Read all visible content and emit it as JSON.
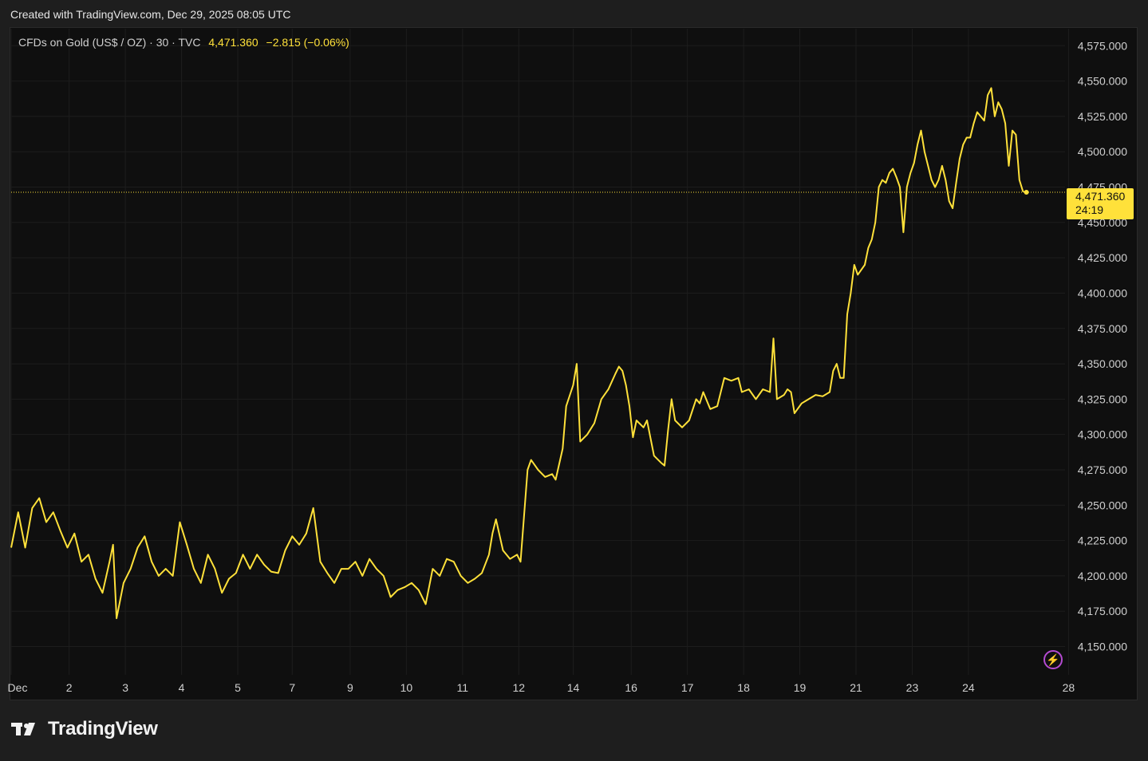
{
  "header": {
    "created_text": "Created with TradingView.com, Dec 29, 2025 08:05 UTC"
  },
  "legend": {
    "symbol": "CFDs on Gold (US$ / OZ) · 30 · TVC",
    "price": "4,471.360",
    "change": "−2.815 (−0.06%)"
  },
  "price_label": {
    "price": "4,471.360",
    "countdown": "24:19"
  },
  "brand": {
    "name": "TradingView"
  },
  "colors": {
    "line": "#ffe13a",
    "background": "#0f0f0f",
    "grid": "#1d1d1d",
    "axis_text": "#cfcfcf",
    "outer": "#1e1e1e"
  },
  "chart_data": {
    "type": "line",
    "series": [
      {
        "values": [
          [
            0,
            4220
          ],
          [
            4,
            4245
          ],
          [
            8,
            4220
          ],
          [
            12,
            4248
          ],
          [
            16,
            4255
          ],
          [
            20,
            4238
          ],
          [
            24,
            4245
          ],
          [
            28,
            4232
          ],
          [
            32,
            4220
          ],
          [
            36,
            4230
          ],
          [
            40,
            4210
          ],
          [
            44,
            4215
          ],
          [
            48,
            4198
          ],
          [
            52,
            4188
          ],
          [
            56,
            4210
          ],
          [
            58,
            4222
          ],
          [
            60,
            4170
          ],
          [
            64,
            4195
          ],
          [
            68,
            4205
          ],
          [
            72,
            4220
          ],
          [
            76,
            4228
          ],
          [
            80,
            4210
          ],
          [
            84,
            4200
          ],
          [
            88,
            4205
          ],
          [
            92,
            4200
          ],
          [
            96,
            4238
          ],
          [
            100,
            4222
          ],
          [
            104,
            4205
          ],
          [
            108,
            4195
          ],
          [
            112,
            4215
          ],
          [
            116,
            4205
          ],
          [
            120,
            4188
          ],
          [
            124,
            4198
          ],
          [
            128,
            4202
          ],
          [
            132,
            4215
          ],
          [
            136,
            4205
          ],
          [
            140,
            4215
          ],
          [
            144,
            4208
          ],
          [
            148,
            4203
          ],
          [
            152,
            4202
          ],
          [
            156,
            4218
          ],
          [
            160,
            4228
          ],
          [
            164,
            4222
          ],
          [
            168,
            4230
          ],
          [
            172,
            4248
          ],
          [
            176,
            4210
          ],
          [
            180,
            4202
          ],
          [
            184,
            4195
          ],
          [
            188,
            4205
          ],
          [
            192,
            4205
          ],
          [
            196,
            4210
          ],
          [
            200,
            4200
          ],
          [
            204,
            4212
          ],
          [
            208,
            4205
          ],
          [
            212,
            4200
          ],
          [
            216,
            4185
          ],
          [
            220,
            4190
          ],
          [
            224,
            4192
          ],
          [
            228,
            4195
          ],
          [
            232,
            4190
          ],
          [
            236,
            4180
          ],
          [
            240,
            4205
          ],
          [
            244,
            4200
          ],
          [
            248,
            4212
          ],
          [
            252,
            4210
          ],
          [
            256,
            4200
          ],
          [
            260,
            4195
          ],
          [
            264,
            4198
          ],
          [
            268,
            4202
          ],
          [
            272,
            4215
          ],
          [
            274,
            4230
          ],
          [
            276,
            4240
          ],
          [
            280,
            4218
          ],
          [
            284,
            4212
          ],
          [
            288,
            4215
          ],
          [
            290,
            4210
          ],
          [
            294,
            4275
          ],
          [
            296,
            4282
          ],
          [
            300,
            4275
          ],
          [
            304,
            4270
          ],
          [
            308,
            4272
          ],
          [
            310,
            4268
          ],
          [
            314,
            4290
          ],
          [
            316,
            4320
          ],
          [
            320,
            4335
          ],
          [
            322,
            4350
          ],
          [
            324,
            4295
          ],
          [
            328,
            4300
          ],
          [
            332,
            4308
          ],
          [
            336,
            4325
          ],
          [
            340,
            4332
          ],
          [
            344,
            4343
          ],
          [
            346,
            4348
          ],
          [
            348,
            4345
          ],
          [
            350,
            4335
          ],
          [
            352,
            4320
          ],
          [
            354,
            4298
          ],
          [
            356,
            4310
          ],
          [
            360,
            4305
          ],
          [
            362,
            4310
          ],
          [
            366,
            4285
          ],
          [
            370,
            4280
          ],
          [
            372,
            4278
          ],
          [
            374,
            4303
          ],
          [
            376,
            4325
          ],
          [
            378,
            4310
          ],
          [
            382,
            4305
          ],
          [
            386,
            4310
          ],
          [
            390,
            4325
          ],
          [
            392,
            4322
          ],
          [
            394,
            4330
          ],
          [
            398,
            4318
          ],
          [
            402,
            4320
          ],
          [
            406,
            4340
          ],
          [
            410,
            4338
          ],
          [
            414,
            4340
          ],
          [
            416,
            4330
          ],
          [
            420,
            4332
          ],
          [
            424,
            4325
          ],
          [
            428,
            4332
          ],
          [
            432,
            4330
          ],
          [
            434,
            4368
          ],
          [
            436,
            4325
          ],
          [
            440,
            4328
          ],
          [
            442,
            4332
          ],
          [
            444,
            4330
          ],
          [
            446,
            4315
          ],
          [
            450,
            4322
          ],
          [
            454,
            4325
          ],
          [
            458,
            4328
          ],
          [
            462,
            4327
          ],
          [
            466,
            4330
          ],
          [
            468,
            4345
          ],
          [
            470,
            4350
          ],
          [
            472,
            4340
          ],
          [
            474,
            4340
          ],
          [
            476,
            4385
          ],
          [
            478,
            4400
          ],
          [
            480,
            4420
          ],
          [
            482,
            4413
          ],
          [
            486,
            4420
          ],
          [
            488,
            4432
          ],
          [
            490,
            4438
          ],
          [
            492,
            4450
          ],
          [
            494,
            4475
          ],
          [
            496,
            4480
          ],
          [
            498,
            4478
          ],
          [
            500,
            4485
          ],
          [
            502,
            4488
          ],
          [
            504,
            4482
          ],
          [
            506,
            4475
          ],
          [
            508,
            4443
          ],
          [
            510,
            4475
          ],
          [
            512,
            4485
          ],
          [
            514,
            4492
          ],
          [
            516,
            4505
          ],
          [
            518,
            4515
          ],
          [
            520,
            4500
          ],
          [
            522,
            4490
          ],
          [
            524,
            4480
          ],
          [
            526,
            4475
          ],
          [
            528,
            4480
          ],
          [
            530,
            4490
          ],
          [
            532,
            4480
          ],
          [
            534,
            4465
          ],
          [
            536,
            4460
          ],
          [
            538,
            4478
          ],
          [
            540,
            4495
          ],
          [
            542,
            4505
          ],
          [
            544,
            4510
          ],
          [
            546,
            4510
          ],
          [
            548,
            4520
          ],
          [
            550,
            4528
          ],
          [
            552,
            4525
          ],
          [
            554,
            4522
          ],
          [
            556,
            4540
          ],
          [
            558,
            4545
          ],
          [
            560,
            4525
          ],
          [
            562,
            4535
          ],
          [
            564,
            4530
          ],
          [
            566,
            4520
          ],
          [
            568,
            4490
          ],
          [
            570,
            4515
          ],
          [
            572,
            4512
          ],
          [
            574,
            4480
          ],
          [
            576,
            4472
          ],
          [
            578,
            4471.36
          ]
        ]
      }
    ],
    "x_tick_labels": [
      "Dec",
      "2",
      "3",
      "4",
      "5",
      "7",
      "9",
      "10",
      "11",
      "12",
      "14",
      "16",
      "17",
      "18",
      "19",
      "21",
      "23",
      "24",
      "28"
    ],
    "y_tick_labels": [
      "4,575.000",
      "4,550.000",
      "4,525.000",
      "4,500.000",
      "4,475.000",
      "4,450.000",
      "4,425.000",
      "4,400.000",
      "4,375.000",
      "4,350.000",
      "4,325.000",
      "4,300.000",
      "4,275.000",
      "4,250.000",
      "4,225.000",
      "4,200.000",
      "4,175.000",
      "4,150.000"
    ],
    "y_tick_values": [
      4575,
      4550,
      4525,
      4500,
      4475,
      4450,
      4425,
      4400,
      4375,
      4350,
      4325,
      4300,
      4275,
      4250,
      4225,
      4200,
      4175,
      4150
    ],
    "ylim": [
      4130,
      4587
    ],
    "x_range": [
      0,
      600
    ],
    "last_price": 4471.36,
    "grid": true
  }
}
